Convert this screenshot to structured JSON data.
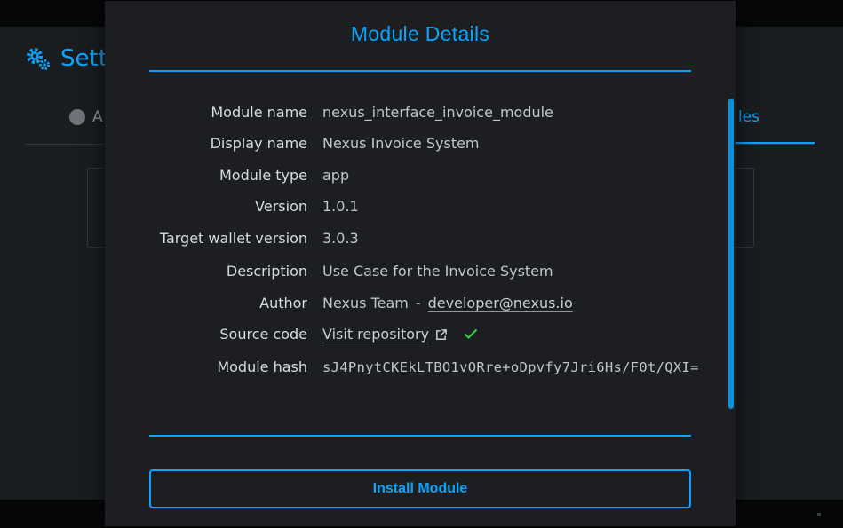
{
  "background": {
    "settings_title": "Sett",
    "tab_left_label": "A",
    "tab_right_label": "les"
  },
  "modal": {
    "title": "Module Details",
    "rows": [
      {
        "label": "Module name",
        "value": "nexus_interface_invoice_module"
      },
      {
        "label": "Display name",
        "value": "Nexus Invoice System"
      },
      {
        "label": "Module type",
        "value": "app"
      },
      {
        "label": "Version",
        "value": "1.0.1"
      },
      {
        "label": "Target wallet version",
        "value": "3.0.3"
      },
      {
        "label": "Description",
        "value": "Use Case for the Invoice System"
      },
      {
        "label": "Author",
        "value": "Nexus Team",
        "separator": "-",
        "email": "developer@nexus.io"
      },
      {
        "label": "Source code",
        "link_text": "Visit repository"
      },
      {
        "label": "Module hash",
        "value": "sJ4PnytCKEkLTBO1vORre+oDpvfy7Jri6Hs/F0t/QXI="
      }
    ],
    "install_button": "Install Module"
  },
  "colors": {
    "accent": "#0ca4fb",
    "verified": "#2ecc40",
    "modal_bg": "#1c1e21"
  },
  "icons": {
    "settings": "gear-icon",
    "tab": "nexus-logo-icon",
    "external_link": "external-link-icon",
    "verified": "check-icon"
  }
}
